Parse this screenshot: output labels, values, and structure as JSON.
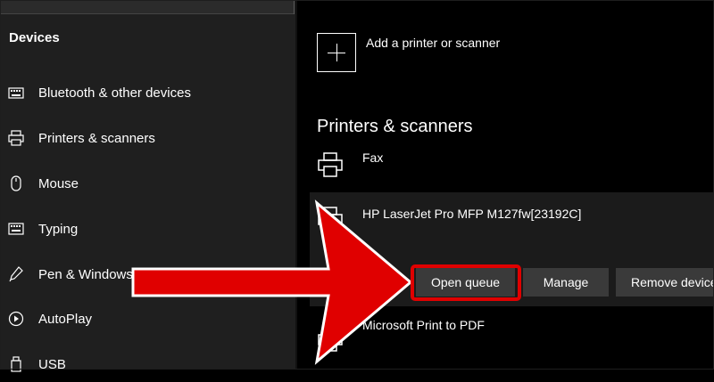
{
  "sidebar": {
    "section_title": "Devices",
    "items": [
      {
        "label": "Bluetooth & other devices",
        "icon": "keyboard-bluetooth-icon"
      },
      {
        "label": "Printers & scanners",
        "icon": "printer-icon"
      },
      {
        "label": "Mouse",
        "icon": "mouse-icon"
      },
      {
        "label": "Typing",
        "icon": "keyboard-icon"
      },
      {
        "label": "Pen & Windows",
        "icon": "pen-icon"
      },
      {
        "label": "AutoPlay",
        "icon": "autoplay-icon"
      },
      {
        "label": "USB",
        "icon": "usb-icon"
      }
    ]
  },
  "main": {
    "add_device_label": "Add a printer or scanner",
    "section_header": "Printers & scanners",
    "printers": [
      {
        "name": "Fax"
      },
      {
        "name": "HP LaserJet Pro MFP M127fw[23192C]",
        "selected": true
      },
      {
        "name": "Microsoft Print to PDF"
      }
    ],
    "actions": {
      "open_queue": "Open queue",
      "manage": "Manage",
      "remove_device": "Remove device"
    }
  },
  "annotation": {
    "highlight_color": "#e00000",
    "arrow_color": "#e00000"
  }
}
